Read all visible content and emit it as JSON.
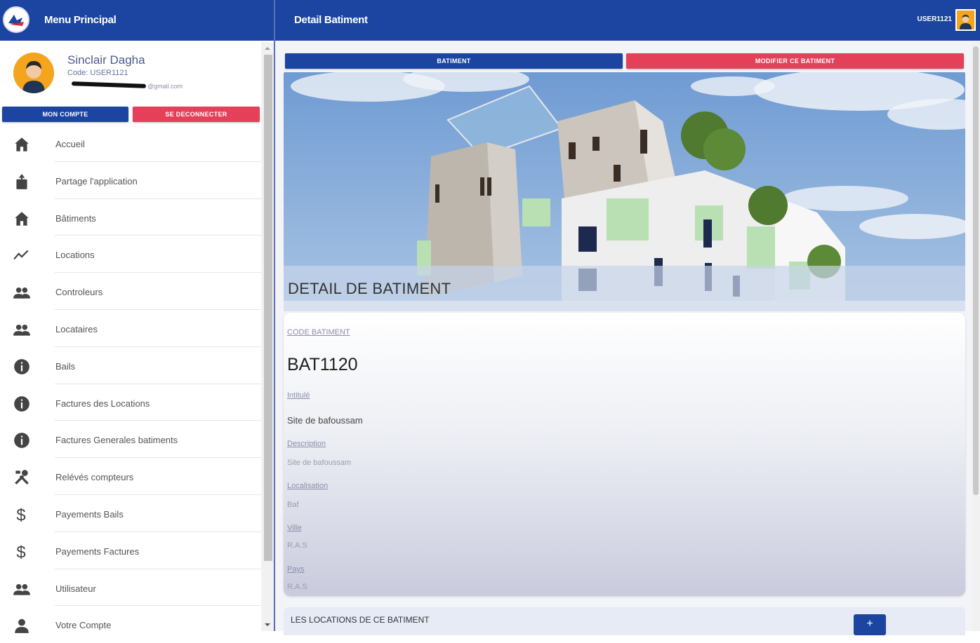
{
  "sidebar": {
    "app_title": "Menu Principal",
    "profile": {
      "name": "Sinclair Dagha",
      "code": "Code: USER1121",
      "email": "@gmail.com"
    },
    "buttons": {
      "account": "MON COMPTE",
      "logout": "SE DECONNECTER"
    },
    "items": [
      {
        "label": "Accueil",
        "icon": "home-icon"
      },
      {
        "label": "Partage l'application",
        "icon": "share-icon"
      },
      {
        "label": "Bâtiments",
        "icon": "building-icon"
      },
      {
        "label": "Locations",
        "icon": "trending-icon"
      },
      {
        "label": "Controleurs",
        "icon": "people-icon"
      },
      {
        "label": "Locataires",
        "icon": "people-icon"
      },
      {
        "label": "Bails",
        "icon": "info-icon"
      },
      {
        "label": "Factures des Locations",
        "icon": "info-icon"
      },
      {
        "label": "Factures Generales batiments",
        "icon": "info-icon"
      },
      {
        "label": "Relévés compteurs",
        "icon": "tools-icon"
      },
      {
        "label": "Payements Bails",
        "icon": "dollar-icon"
      },
      {
        "label": "Payements Factures",
        "icon": "dollar-icon"
      },
      {
        "label": "Utilisateur",
        "icon": "people-icon"
      },
      {
        "label": "Votre Compte",
        "icon": "person-icon"
      }
    ]
  },
  "header": {
    "title": "Detail Batiment",
    "user_code": "USER1121"
  },
  "tabs": {
    "building": "BATIMENT",
    "edit": "MODIFIER CE BATIMENT"
  },
  "hero": {
    "title": "DETAIL DE BATIMENT"
  },
  "details": {
    "code_label": "CODE BATIMENT",
    "code_value": "BAT1120",
    "intitule_label": "Intitulé",
    "intitule_value": "Site de bafoussam",
    "description_label": "Description",
    "description_value": "Site de bafoussam",
    "localisation_label": "Localisation",
    "localisation_value": "Baf",
    "ville_label": "Ville",
    "ville_value": "R.A.S",
    "pays_label": "Pays",
    "pays_value": "R.A.S"
  },
  "locations": {
    "title": "LES LOCATIONS DE CE BATIMENT",
    "add_label": "+"
  },
  "colors": {
    "primary": "#1b45a0",
    "danger": "#e4405a",
    "avatar": "#f4a51d"
  }
}
